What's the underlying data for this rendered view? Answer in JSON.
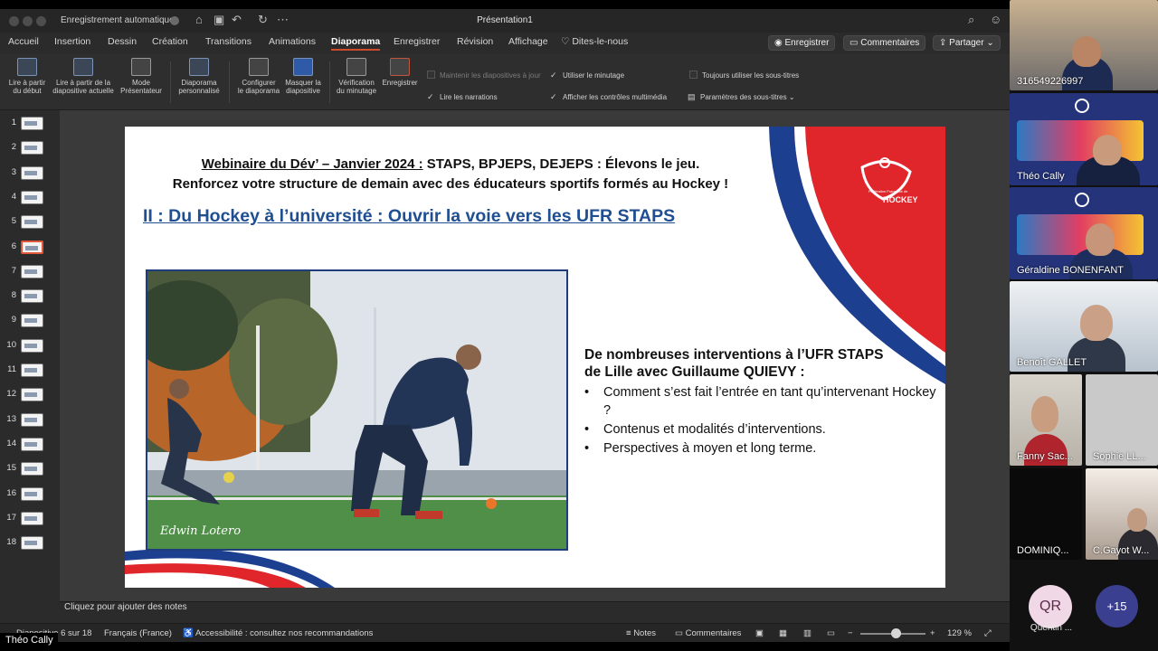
{
  "window": {
    "autosave_label": "Enregistrement automatique",
    "doc_title": "Présentation1"
  },
  "tabs": [
    "Accueil",
    "Insertion",
    "Dessin",
    "Création",
    "Transitions",
    "Animations",
    "Diaporama",
    "Enregistrer",
    "Révision",
    "Affichage",
    "Dites-le-nous"
  ],
  "active_tab": "Diaporama",
  "actions": {
    "record": "Enregistrer",
    "comments": "Commentaires",
    "share": "Partager"
  },
  "ribbon": {
    "from_start": [
      "Lire à partir",
      "du début"
    ],
    "from_current": [
      "Lire à partir de la",
      "diapositive actuelle"
    ],
    "presenter": [
      "Mode",
      "Présentateur"
    ],
    "custom": [
      "Diaporama",
      "personnalisé"
    ],
    "setup": [
      "Configurer",
      "le diaporama"
    ],
    "hide": [
      "Masquer la",
      "diapositive"
    ],
    "rehearse": [
      "Vérification",
      "du minutage"
    ],
    "record": "Enregistrer",
    "options": {
      "keep_updated": "Maintenir les diapositives à jour",
      "use_timings": "Utiliser le minutage",
      "play_narrations": "Lire les narrations",
      "show_media": "Afficher les contrôles multimédia",
      "always_subtitles": "Toujours utiliser les sous-titres",
      "subtitle_settings": "Paramètres des sous-titres"
    }
  },
  "thumbnails": [
    "1",
    "2",
    "3",
    "4",
    "5",
    "6",
    "7",
    "8",
    "9",
    "10",
    "11",
    "12",
    "13",
    "14",
    "15",
    "16",
    "17",
    "18"
  ],
  "active_slide_index": 6,
  "slide": {
    "title_underlined": "Webinaire du Dév’ – Janvier 2024 :",
    "title_rest": " STAPS, BPJEPS, DEJEPS : Élevons le jeu.",
    "subtitle": "Renforcez votre structure de demain avec des éducateurs sportifs formés au Hockey !",
    "heading": "II : Du Hockey à l’université : Ouvrir la voie vers les UFR STAPS",
    "photo_signature": "Edwin Lotero",
    "bullet_heading": [
      "De nombreuses interventions à l’UFR STAPS",
      "de Lille avec Guillaume QUIEVY :"
    ],
    "bullets": [
      "Comment s’est fait l’entrée en tant qu’intervenant Hockey ?",
      "Contenus et modalités d’interventions.",
      "Perspectives à moyen et long terme."
    ],
    "logo_small": "Fédération Française de",
    "logo_text": "HOCKEY"
  },
  "notes_placeholder": "Cliquez pour ajouter des notes",
  "status": {
    "slide_info": "Diapositive 6 sur 18",
    "language": "Français (France)",
    "accessibility": "Accessibilité : consultez nos recommandations",
    "notes": "Notes",
    "comments": "Commentaires",
    "zoom": "129 %"
  },
  "owner": "Théo Cally",
  "participants": [
    {
      "label": "316549226997"
    },
    {
      "label": "Théo Cally"
    },
    {
      "label": "Géraldine BONENFANT"
    },
    {
      "label": "Benoît GALLET"
    },
    {
      "label": "Fanny Sac..."
    },
    {
      "label": "Sophie LL..."
    },
    {
      "label": "DOMINIQ..."
    },
    {
      "label": "C.Gayot W..."
    }
  ],
  "avatar": {
    "initials": "QR",
    "name": "Quentin ..."
  },
  "more_participants": "+15",
  "colors": {
    "accent": "#d04a2c",
    "slide_heading": "#1f4e91",
    "ff_blue": "#1d3f8f",
    "ff_red": "#e0262b"
  }
}
